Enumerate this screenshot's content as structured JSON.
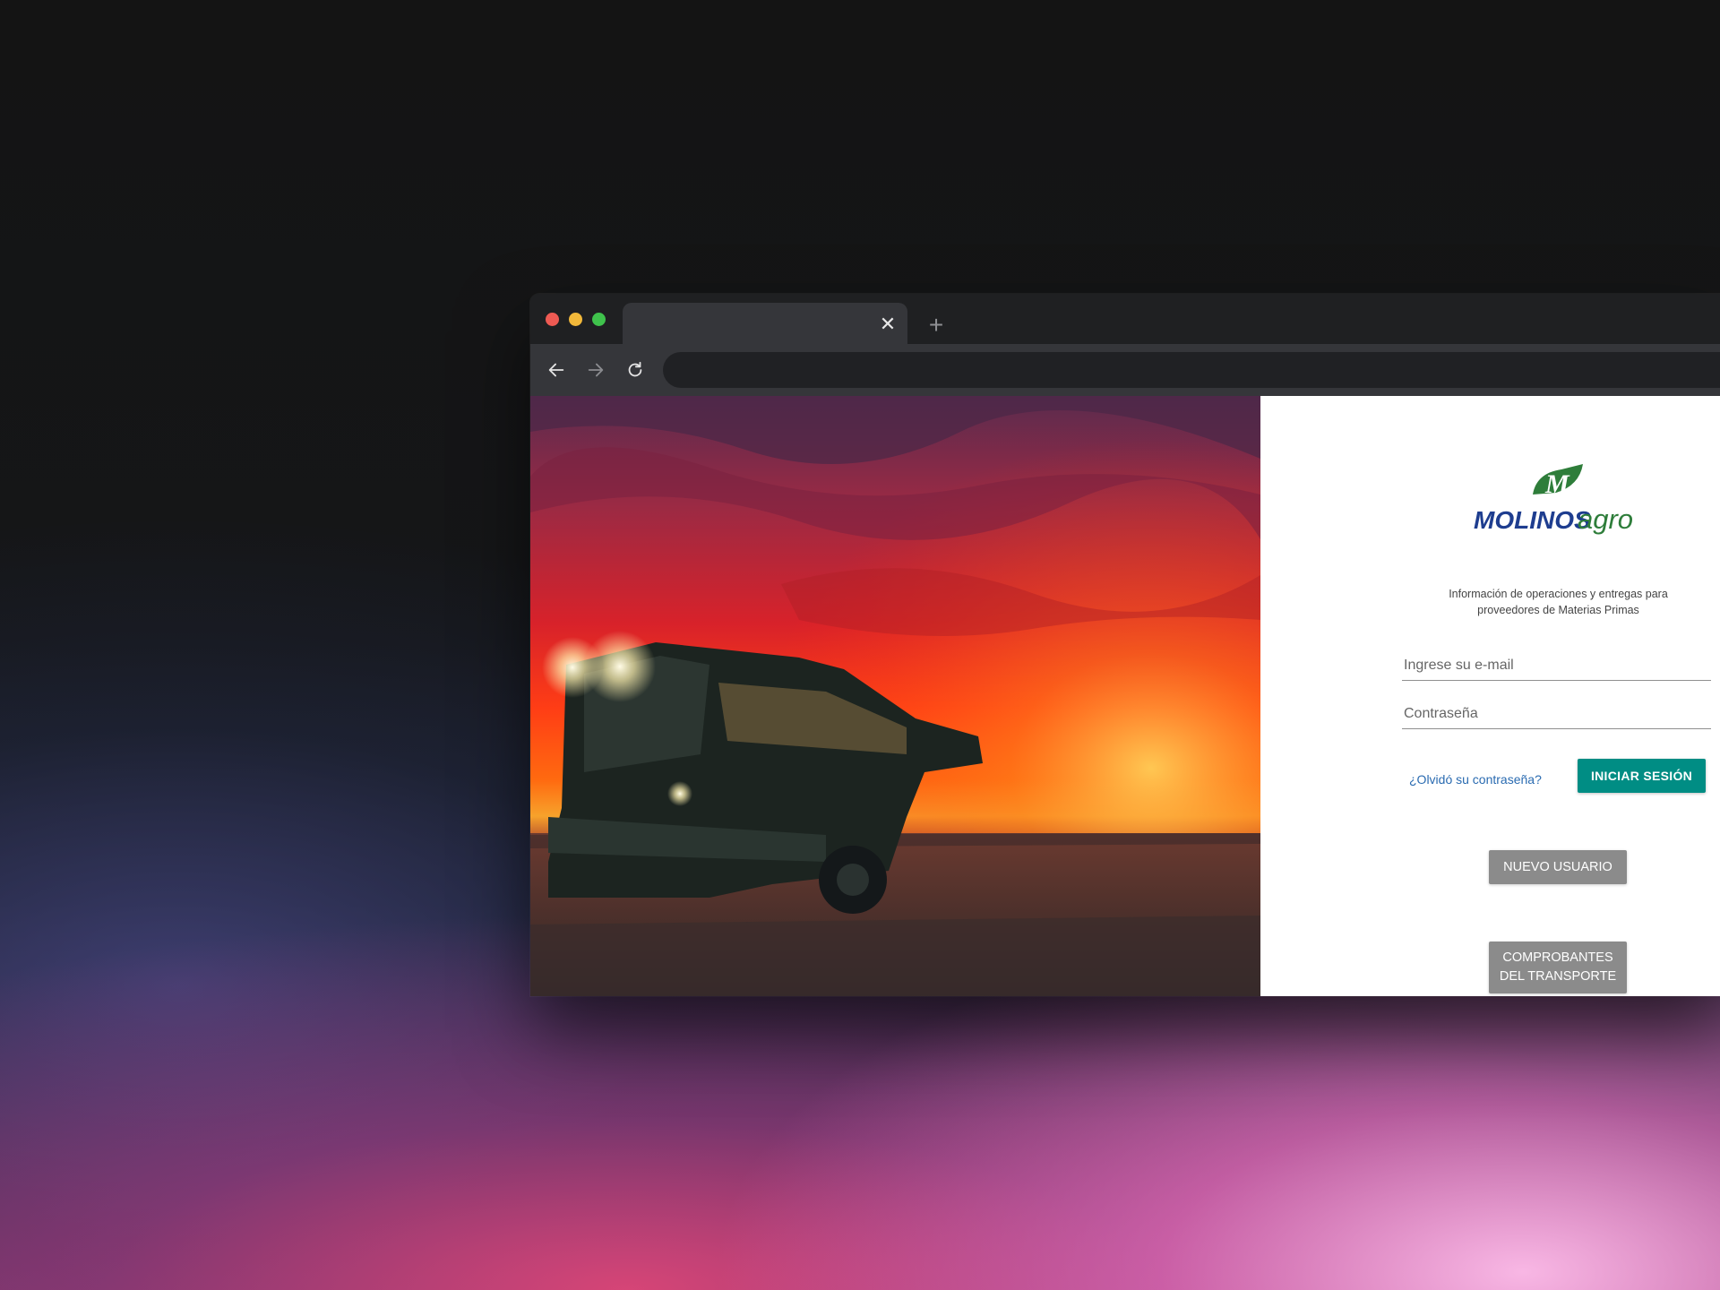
{
  "window": {
    "tab": {
      "title": "",
      "close_glyph": "✕"
    },
    "new_tab_glyph": "+",
    "address_bar": {
      "url": ""
    }
  },
  "page": {
    "hero_image": "combine-harvester-sunset",
    "logo": {
      "wordmark_1": "MOLINOS",
      "wordmark_2": "agro",
      "monogram": "M"
    },
    "subtitle": "Información de operaciones y entregas para proveedores de Materias Primas",
    "email": {
      "placeholder": "Ingrese su e-mail",
      "value": ""
    },
    "password": {
      "placeholder": "Contraseña",
      "value": ""
    },
    "forgot_link": "¿Olvidó su contraseña?",
    "login_button": "INICIAR SESIÓN",
    "new_user_button": "NUEVO USUARIO",
    "transport_button": "COMPROBANTES\nDEL TRANSPORTE"
  },
  "colors": {
    "accent": "#008d84",
    "secondary_button": "#8b8b8b",
    "link": "#2a6bb1",
    "logo_blue": "#1e3d8f",
    "logo_green": "#2e7d3a"
  }
}
